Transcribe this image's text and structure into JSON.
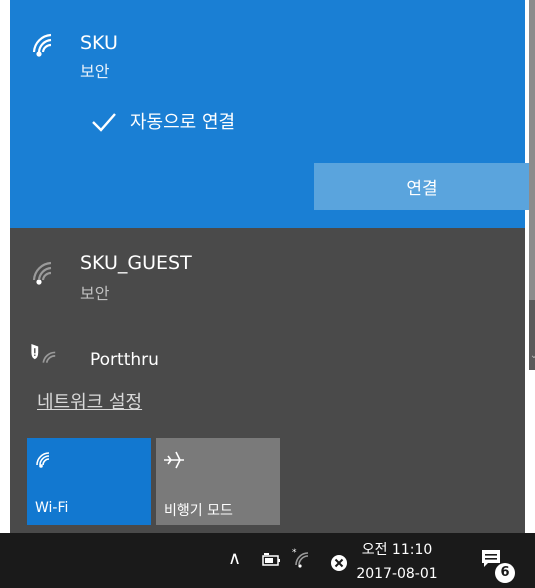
{
  "flyout": {
    "networks": [
      {
        "name": "SKU",
        "status": "보안",
        "selected": true
      },
      {
        "name": "SKU_GUEST",
        "status": "보안",
        "selected": false
      },
      {
        "name": "Portthru",
        "selected": false
      }
    ],
    "auto_connect": {
      "label": "자동으로 연결",
      "checked": true
    },
    "connect_label": "연결",
    "settings_link": "네트워크 설정"
  },
  "quick_actions": [
    {
      "label": "Wi-Fi",
      "active": true
    },
    {
      "label": "비행기 모드",
      "active": false
    }
  ],
  "taskbar": {
    "time": "오전 11:10",
    "date": "2017-08-01",
    "notification_count": "6"
  },
  "colors": {
    "accent": "#1a7fd4",
    "panel": "#4a4a4a",
    "connect_button": "#5aa4dd",
    "taskbar": "#1a1a1a"
  }
}
